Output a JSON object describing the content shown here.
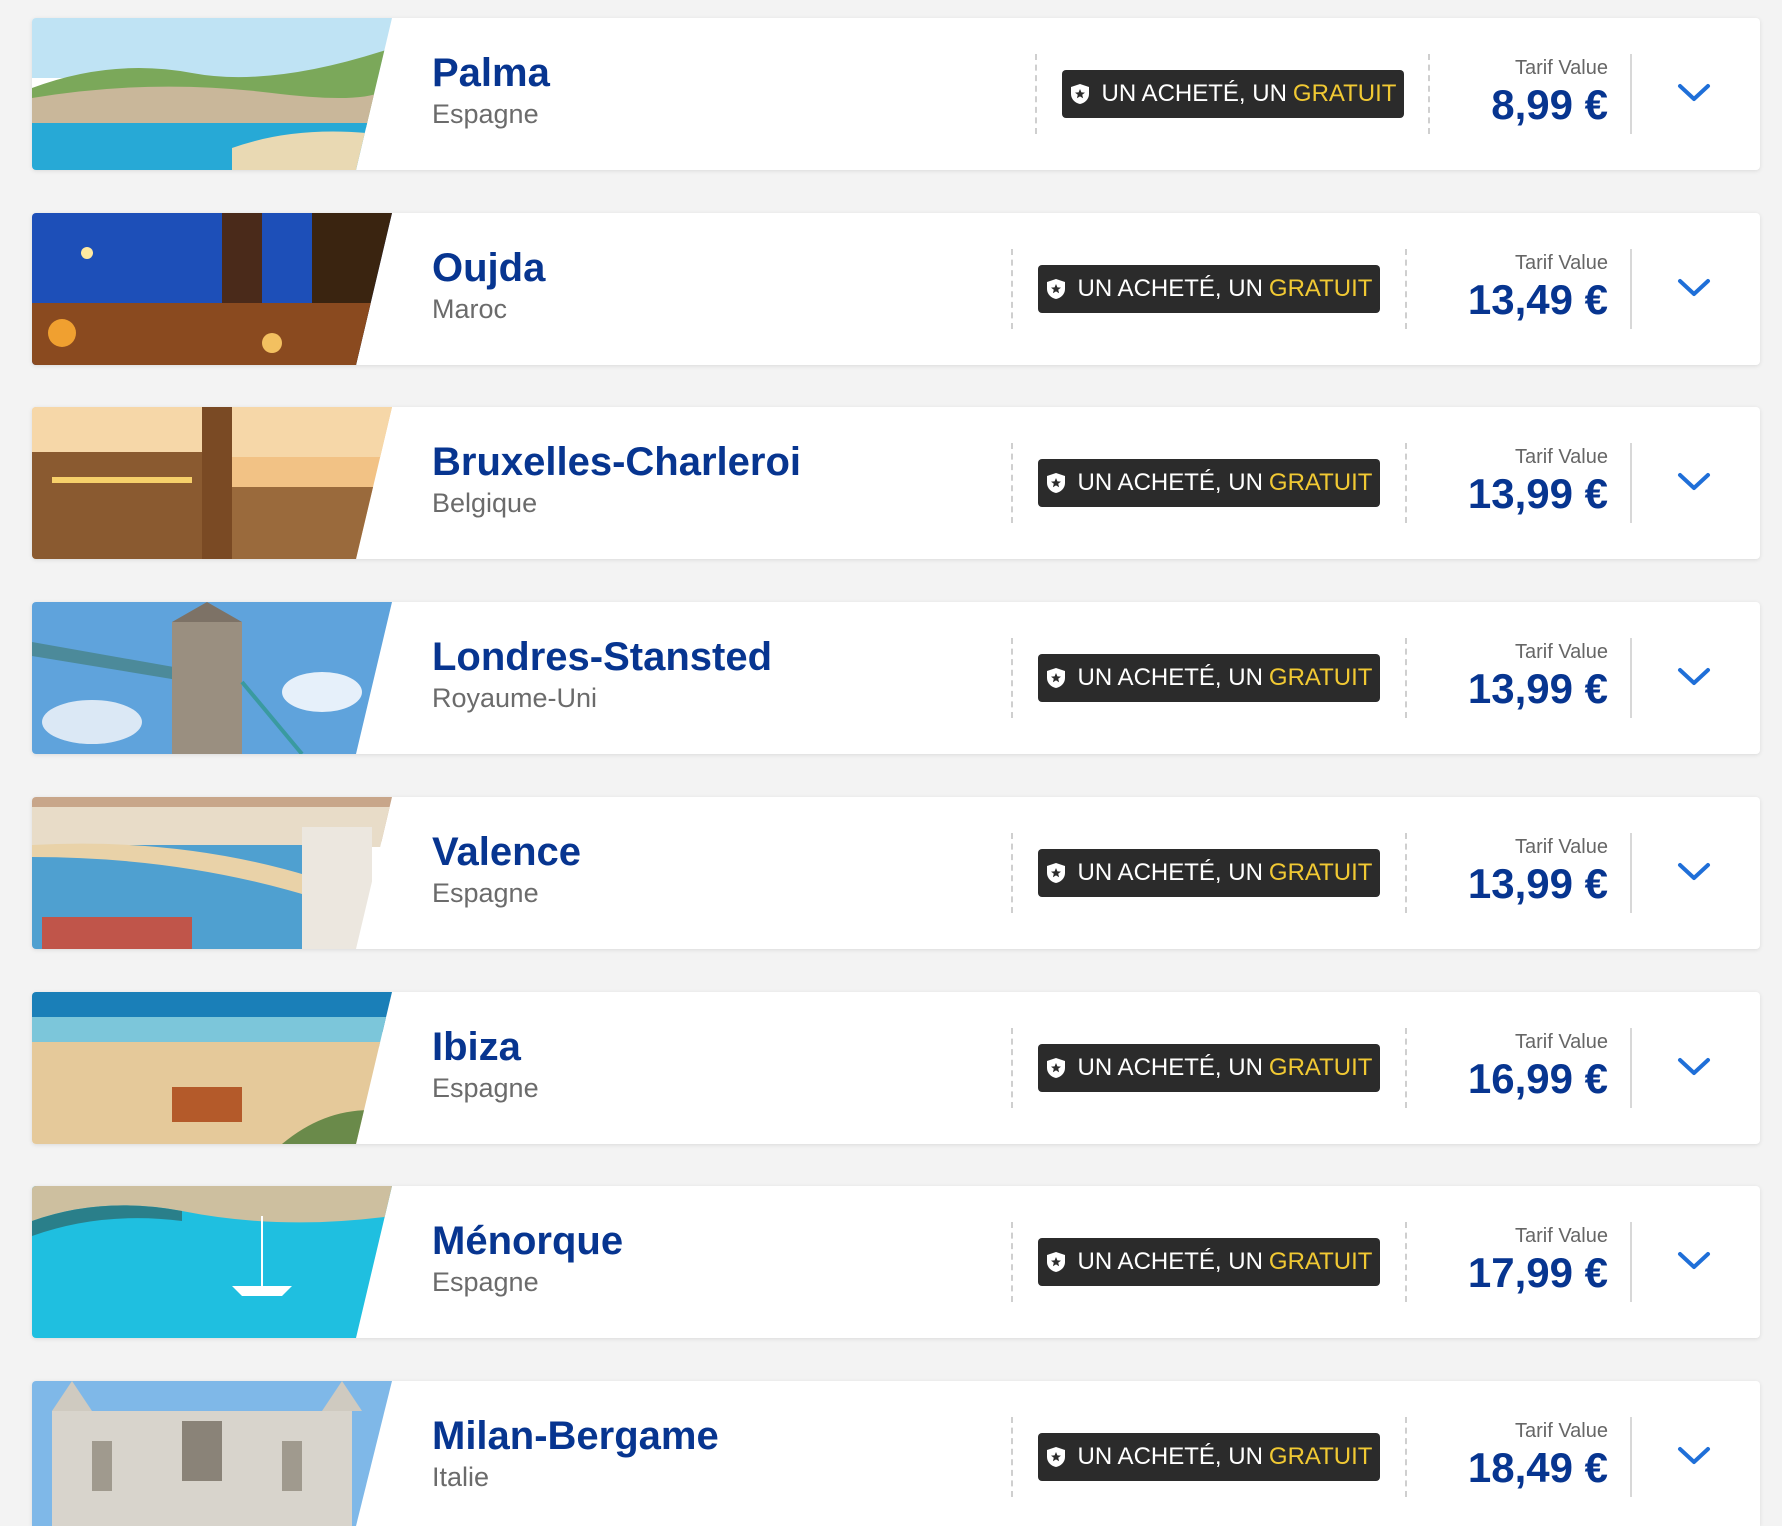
{
  "offers": [
    {
      "city": "Palma",
      "country": "Espagne",
      "promo_text": "UN ACHETÉ, UN",
      "promo_highlight": "GRATUIT",
      "fare_label": "Tarif Value",
      "price": "8,99 €"
    },
    {
      "city": "Oujda",
      "country": "Maroc",
      "promo_text": "UN ACHETÉ, UN",
      "promo_highlight": "GRATUIT",
      "fare_label": "Tarif Value",
      "price": "13,49 €"
    },
    {
      "city": "Bruxelles-Charleroi",
      "country": "Belgique",
      "promo_text": "UN ACHETÉ, UN",
      "promo_highlight": "GRATUIT",
      "fare_label": "Tarif Value",
      "price": "13,99 €"
    },
    {
      "city": "Londres-Stansted",
      "country": "Royaume-Uni",
      "promo_text": "UN ACHETÉ, UN",
      "promo_highlight": "GRATUIT",
      "fare_label": "Tarif Value",
      "price": "13,99 €"
    },
    {
      "city": "Valence",
      "country": "Espagne",
      "promo_text": "UN ACHETÉ, UN",
      "promo_highlight": "GRATUIT",
      "fare_label": "Tarif Value",
      "price": "13,99 €"
    },
    {
      "city": "Ibiza",
      "country": "Espagne",
      "promo_text": "UN ACHETÉ, UN",
      "promo_highlight": "GRATUIT",
      "fare_label": "Tarif Value",
      "price": "16,99 €"
    },
    {
      "city": "Ménorque",
      "country": "Espagne",
      "promo_text": "UN ACHETÉ, UN",
      "promo_highlight": "GRATUIT",
      "fare_label": "Tarif Value",
      "price": "17,99 €"
    },
    {
      "city": "Milan-Bergame",
      "country": "Italie",
      "promo_text": "UN ACHETÉ, UN",
      "promo_highlight": "GRATUIT",
      "fare_label": "Tarif Value",
      "price": "18,49 €"
    }
  ],
  "icons": {
    "promo": "shield-star-icon",
    "expand": "chevron-down-icon"
  },
  "colors": {
    "brand_blue": "#073590",
    "accent_yellow": "#f1c933",
    "badge_bg": "#2b2b2b",
    "chevron_blue": "#1f6fd8"
  }
}
